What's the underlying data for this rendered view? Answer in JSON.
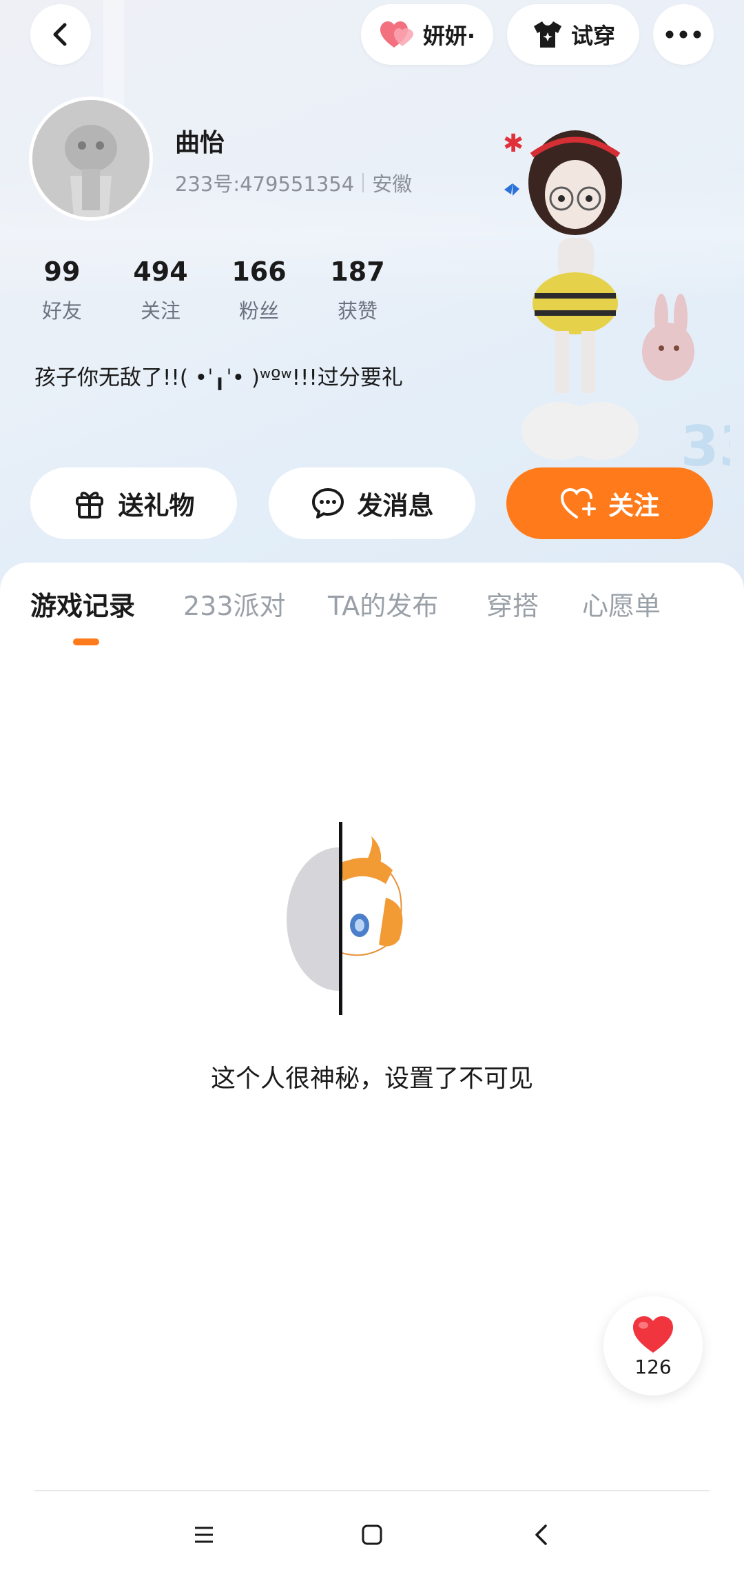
{
  "top_bar": {
    "partner_label": "妍妍·",
    "tryon_label": "试穿"
  },
  "profile": {
    "name": "曲怡",
    "id_text": "233号:479551354",
    "location": "安徽",
    "bio": "孩子你无敌了!!( •ˈ╻ˈ• )ʷºʷ!!!过分要礼"
  },
  "stats": [
    {
      "value": "99",
      "label": "好友"
    },
    {
      "value": "494",
      "label": "关注"
    },
    {
      "value": "166",
      "label": "粉丝"
    },
    {
      "value": "187",
      "label": "获赞"
    }
  ],
  "actions": {
    "gift_label": "送礼物",
    "message_label": "发消息",
    "follow_label": "关注"
  },
  "tabs": [
    {
      "label": "游戏记录",
      "active": true
    },
    {
      "label": "233派对"
    },
    {
      "label": "TA的发布"
    },
    {
      "label": "穿搭"
    },
    {
      "label": "心愿单"
    }
  ],
  "empty_state": {
    "message": "这个人很神秘，设置了不可见"
  },
  "like_float": {
    "count": "126"
  },
  "colors": {
    "accent": "#ff7a1a",
    "like_red": "#f0353f",
    "partner_pink": "#f3707f"
  }
}
